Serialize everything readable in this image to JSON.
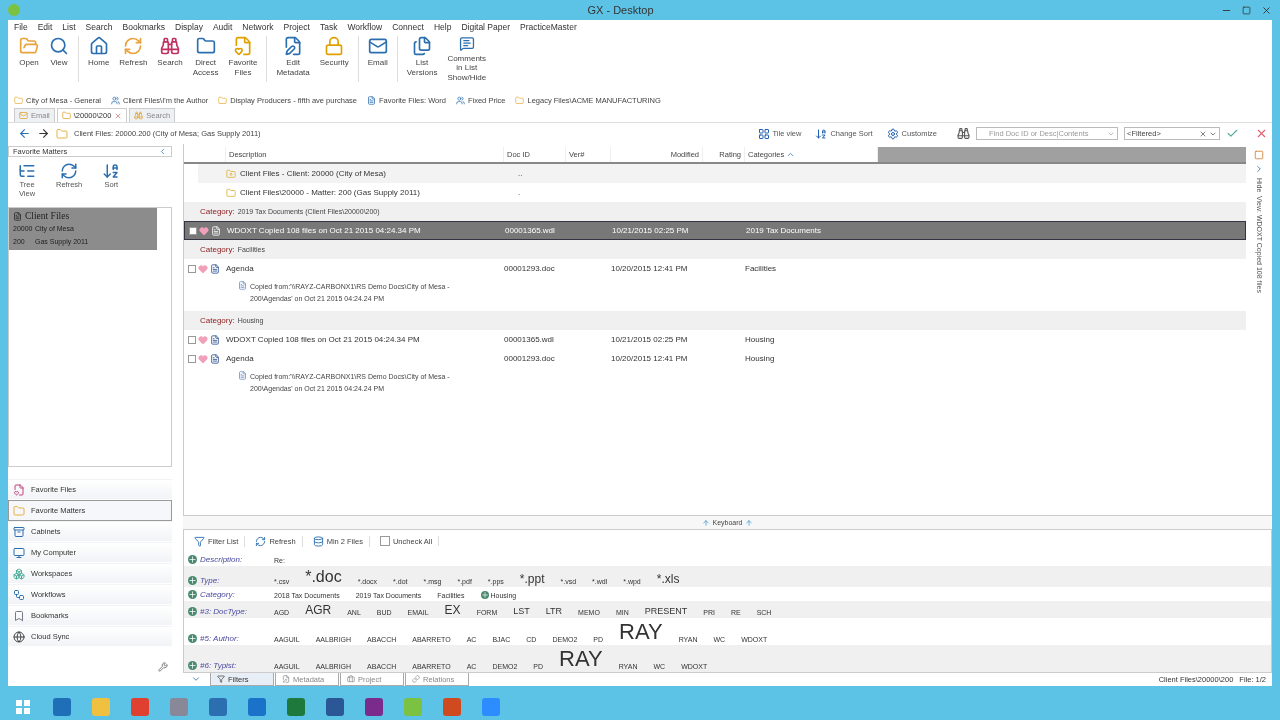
{
  "window": {
    "title": "GX - Desktop"
  },
  "menu": [
    "File",
    "Edit",
    "List",
    "Search",
    "Bookmarks",
    "Display",
    "Audit",
    "Network",
    "Project",
    "Task",
    "Workflow",
    "Connect",
    "Help",
    "Digital Paper",
    "PracticeMaster"
  ],
  "ribbon": [
    [
      {
        "label": "Open"
      },
      {
        "label": "View"
      }
    ],
    [
      {
        "label": "Home"
      },
      {
        "label": "Refresh"
      },
      {
        "label": "Search"
      },
      {
        "label": "Direct\nAccess"
      },
      {
        "label": "Favorite\nFiles"
      }
    ],
    [
      {
        "label": "Edit\nMetadata"
      },
      {
        "label": "Security"
      }
    ],
    [
      {
        "label": "Email"
      }
    ],
    [
      {
        "label": "List\nVersions"
      },
      {
        "label": "Comments\nin List\nShow/Hide"
      }
    ]
  ],
  "favorites": [
    {
      "label": "City of Mesa - General"
    },
    {
      "label": "Client Files\\I'm the Author"
    },
    {
      "label": "Display Producers -  fifth ave purchase"
    },
    {
      "label": "Favorite Files: Word"
    },
    {
      "label": "Fixed Price"
    },
    {
      "label": "Legacy Files\\ACME MANUFACTURING"
    }
  ],
  "doc_tabs": [
    {
      "label": "Email",
      "selected": false
    },
    {
      "label": "\\20000\\200",
      "selected": true
    },
    {
      "label": "Search",
      "selected": false
    }
  ],
  "nav": {
    "path": "Client Files: 20000.200 (City of Mesa; Gas Supply 2011)",
    "view_buttons": [
      "Tile view",
      "Change Sort",
      "Customize"
    ],
    "search_placeholder": "Find Doc ID or Desc|Contents",
    "filter": "<Filtered>"
  },
  "left": {
    "title": "Favorite Matters",
    "tools": [
      "Tree\nView",
      "Refresh",
      "Sort"
    ],
    "tree": {
      "title": "Client Files",
      "selected": true,
      "rows": [
        {
          "number": "20000",
          "name": "City of Mesa"
        },
        {
          "number": "200",
          "name": "Gas Supply 2011"
        }
      ]
    },
    "nav_items": [
      {
        "label": "Favorite Files",
        "selected": false
      },
      {
        "label": "Favorite Matters",
        "selected": true
      },
      {
        "label": "Cabinets",
        "selected": false
      },
      {
        "label": "My Computer",
        "selected": false
      },
      {
        "label": "Workspaces",
        "selected": false
      },
      {
        "label": "Workflows",
        "selected": false
      },
      {
        "label": "Bookmarks",
        "selected": false
      },
      {
        "label": "Cloud Sync",
        "selected": false
      }
    ]
  },
  "list": {
    "columns": [
      {
        "label": "Description"
      },
      {
        "label": "Doc ID"
      },
      {
        "label": "Ver#"
      },
      {
        "label": "Modified"
      },
      {
        "label": "Rating"
      },
      {
        "label": "Categories",
        "sorted_ascending": true
      }
    ],
    "rows": [
      {
        "kind": "parent",
        "description": "Client Files - Client: 20000 (City of Mesa)",
        "doc_id": ".."
      },
      {
        "kind": "folder",
        "description": "Client Files\\20000 - Matter: 200 (Gas Supply 2011)",
        "doc_id": "."
      },
      {
        "kind": "category",
        "label": "Category:",
        "value": "2019 Tax Documents (Client Files\\20000\\200)"
      },
      {
        "kind": "doc",
        "checked": false,
        "selected": true,
        "description": "WDOXT Copied 108 files on Oct 21 2015 04:24.34 PM",
        "doc_id": "00001365.wdl",
        "modified": "10/21/2015 02:25 PM",
        "category": "2019 Tax Documents"
      },
      {
        "kind": "category",
        "label": "Category:",
        "value": "Facilities"
      },
      {
        "kind": "doc",
        "checked": false,
        "selected": false,
        "description": "Agenda",
        "doc_id": "00001293.doc",
        "modified": "10/20/2015 12:41 PM",
        "category": "Facilities",
        "note": "Copied from:'\\\\RAYZ-CARBONX1\\RS Demo Docs\\City of Mesa -\n200\\Agendas' on Oct 21 2015 04:24.24 PM"
      },
      {
        "kind": "category",
        "label": "Category:",
        "value": "Housing"
      },
      {
        "kind": "doc",
        "checked": false,
        "selected": false,
        "description": "WDOXT Copied 108 files on Oct 21 2015 04:24.34 PM",
        "doc_id": "00001365.wdl",
        "modified": "10/21/2015 02:25 PM",
        "category": "Housing"
      },
      {
        "kind": "doc",
        "checked": false,
        "selected": false,
        "description": "Agenda",
        "doc_id": "00001293.doc",
        "modified": "10/20/2015 12:41 PM",
        "category": "Housing",
        "note": "Copied from:'\\\\RAYZ-CARBONX1\\RS Demo Docs\\City of Mesa -\n200\\Agendas' on Oct 21 2015 04:24.24 PM"
      }
    ]
  },
  "keyboard": "Keyboard",
  "filter_toolbar": [
    {
      "kind": "button",
      "label": "Filter List"
    },
    {
      "kind": "button",
      "label": "Refresh"
    },
    {
      "kind": "button",
      "label": "Min 2 Files"
    },
    {
      "kind": "checkbox",
      "label": "Uncheck All",
      "checked": false
    }
  ],
  "filters": [
    {
      "label": "Description:",
      "values": [
        {
          "text": "Re:",
          "kind": "small"
        }
      ]
    },
    {
      "label": "Type:",
      "values": [
        {
          "text": "*.csv",
          "kind": "small"
        },
        {
          "text": "*.doc",
          "kind": "xlarge"
        },
        {
          "text": "*.docx",
          "kind": "small"
        },
        {
          "text": "*.dot",
          "kind": "small"
        },
        {
          "text": "*.msg",
          "kind": "small"
        },
        {
          "text": "*.pdf",
          "kind": "small"
        },
        {
          "text": "*.pps",
          "kind": "small"
        },
        {
          "text": "*.ppt",
          "kind": "large"
        },
        {
          "text": "*.vsd",
          "kind": "small"
        },
        {
          "text": "*.wdl",
          "kind": "small"
        },
        {
          "text": "*.wpd",
          "kind": "small"
        },
        {
          "text": "*.xls",
          "kind": "large"
        }
      ]
    },
    {
      "label": "Category:",
      "values": [
        {
          "text": "2018 Tax Documents",
          "kind": "small"
        },
        {
          "text": "2019 Tax Documents",
          "kind": "small"
        },
        {
          "text": "Facilities",
          "kind": "small"
        },
        {
          "text": "Housing",
          "kind": "small",
          "added": true
        }
      ]
    },
    {
      "label": "#3: DocType:",
      "values": [
        {
          "text": "AGD",
          "kind": "small"
        },
        {
          "text": "AGR",
          "kind": "large"
        },
        {
          "text": "ANL",
          "kind": "small"
        },
        {
          "text": "BUD",
          "kind": "small"
        },
        {
          "text": "EMAIL",
          "kind": "small"
        },
        {
          "text": "EX",
          "kind": "large"
        },
        {
          "text": "FORM",
          "kind": "small"
        },
        {
          "text": "LST",
          "kind": "medium"
        },
        {
          "text": "LTR",
          "kind": "medium"
        },
        {
          "text": "MEMO",
          "kind": "small"
        },
        {
          "text": "MIN",
          "kind": "small"
        },
        {
          "text": "PRESENT",
          "kind": "medium"
        },
        {
          "text": "PRI",
          "kind": "small"
        },
        {
          "text": "RE",
          "kind": "small"
        },
        {
          "text": "SCH",
          "kind": "small"
        }
      ]
    },
    {
      "label": "#5: Author:",
      "values": [
        {
          "text": "AAGUIL",
          "kind": "small"
        },
        {
          "text": "AALBRIGH",
          "kind": "small"
        },
        {
          "text": "ABACCH",
          "kind": "small"
        },
        {
          "text": "ABARRETO",
          "kind": "small"
        },
        {
          "text": "AC",
          "kind": "small"
        },
        {
          "text": "BJAC",
          "kind": "small"
        },
        {
          "text": "CD",
          "kind": "small"
        },
        {
          "text": "DEMO2",
          "kind": "small"
        },
        {
          "text": "PD",
          "kind": "small"
        },
        {
          "text": "RAY",
          "kind": "huge"
        },
        {
          "text": "RYAN",
          "kind": "small"
        },
        {
          "text": "WC",
          "kind": "small"
        },
        {
          "text": "WDOXT",
          "kind": "small"
        }
      ]
    },
    {
      "label": "#6: Typist:",
      "values": [
        {
          "text": "AAGUIL",
          "kind": "small"
        },
        {
          "text": "AALBRIGH",
          "kind": "small"
        },
        {
          "text": "ABACCH",
          "kind": "small"
        },
        {
          "text": "ABARRETO",
          "kind": "small"
        },
        {
          "text": "AC",
          "kind": "small"
        },
        {
          "text": "DEMO2",
          "kind": "small"
        },
        {
          "text": "PD",
          "kind": "small"
        },
        {
          "text": "RAY",
          "kind": "huge"
        },
        {
          "text": "RYAN",
          "kind": "small"
        },
        {
          "text": "WC",
          "kind": "small"
        },
        {
          "text": "WDOXT",
          "kind": "small"
        }
      ]
    }
  ],
  "bottom_tabs": [
    {
      "label": "Filters",
      "selected": true
    },
    {
      "label": "Metadata",
      "selected": false
    },
    {
      "label": "Project",
      "selected": false
    },
    {
      "label": "Relations",
      "selected": false
    }
  ],
  "side_tabs": [
    "Hide",
    "View: WDOXT Copied 108 files"
  ],
  "status": {
    "path": "Client Files\\20000\\200",
    "file": "File: 1/2"
  }
}
